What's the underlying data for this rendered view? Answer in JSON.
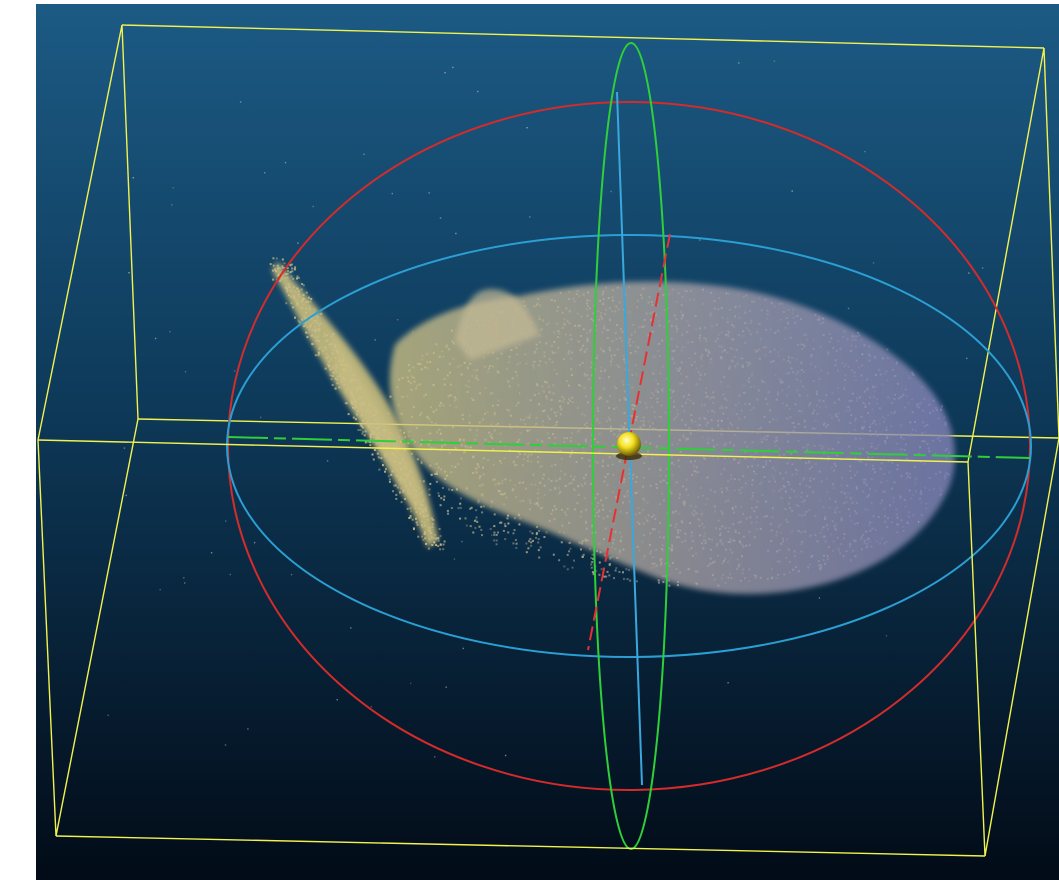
{
  "viewer": {
    "background": {
      "top_color": "#1c5a84",
      "bottom_color": "#020b17"
    },
    "point_cloud": {
      "warm_color": "#cfc283",
      "cool_color": "#8585b8"
    },
    "bounding_box_color": "#f2f24e",
    "ellipsoid": {
      "ring_xy_color": "#d42b2b",
      "ring_xz_color": "#2b9fd4",
      "ring_yz_color": "#2fcf3a",
      "axis_x_color": "#e83030",
      "axis_y_color": "#2fcf3a",
      "axis_z_color": "#3aa7de",
      "center_marker_color": "#f4e21c",
      "center_marker_icon": "sphere-icon"
    }
  }
}
